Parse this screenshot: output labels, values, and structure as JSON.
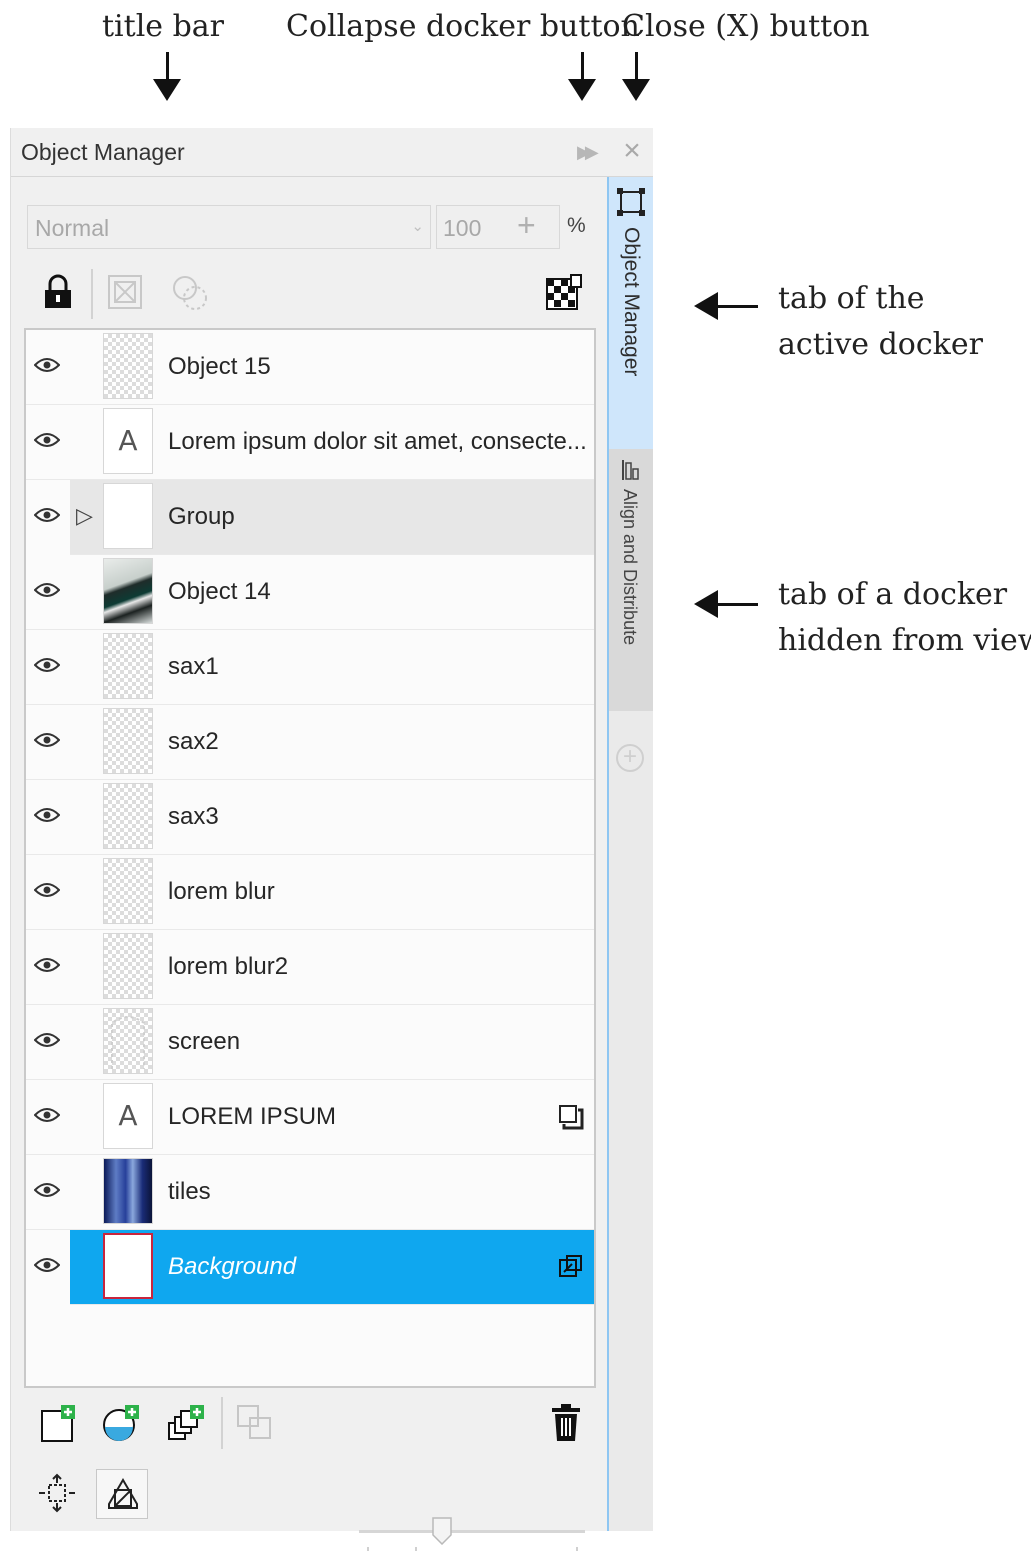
{
  "callouts": {
    "title_bar": "title bar",
    "collapse": "Collapse docker button",
    "close": "Close (X) button",
    "active_tab": [
      "tab of the",
      "active docker"
    ],
    "hidden_tab": [
      "tab of a docker",
      "hidden from view"
    ]
  },
  "docker": {
    "title": "Object Manager",
    "blend_mode": "Normal",
    "opacity": "100",
    "opacity_unit": "%",
    "tabs": {
      "active": "Object Manager",
      "inactive": "Align and Distribute"
    }
  },
  "objects": [
    {
      "name": "Object 15",
      "type": "checker"
    },
    {
      "name": "Lorem ipsum dolor sit amet, consecte...",
      "type": "text"
    },
    {
      "name": "Group",
      "type": "group"
    },
    {
      "name": "Object 14",
      "type": "photo"
    },
    {
      "name": "sax1",
      "type": "checker"
    },
    {
      "name": "sax2",
      "type": "checker"
    },
    {
      "name": "sax3",
      "type": "checker"
    },
    {
      "name": "lorem blur",
      "type": "checker"
    },
    {
      "name": "lorem blur2",
      "type": "checker"
    },
    {
      "name": "screen",
      "type": "screen"
    },
    {
      "name": "LOREM IPSUM",
      "type": "text"
    },
    {
      "name": "tiles",
      "type": "tiles"
    },
    {
      "name": "Background",
      "type": "background",
      "selected": true
    }
  ],
  "icons": {
    "lock": "lock-icon",
    "clip": "clip-mask-icon",
    "color_picker": "color-picker-icon",
    "transparency": "checkered-lock-icon",
    "eye": "eye-icon",
    "new_layer": "new-layer-icon",
    "new_master": "new-master-layer-icon",
    "new_page": "new-layer-stack-icon",
    "delete": "trash-icon",
    "find": "find-icon",
    "view": "view-mode-icon"
  },
  "colors": {
    "selection": "#0fa7ef",
    "active_tab": "#cfe6fb",
    "accent_border": "#8ec6f2"
  }
}
